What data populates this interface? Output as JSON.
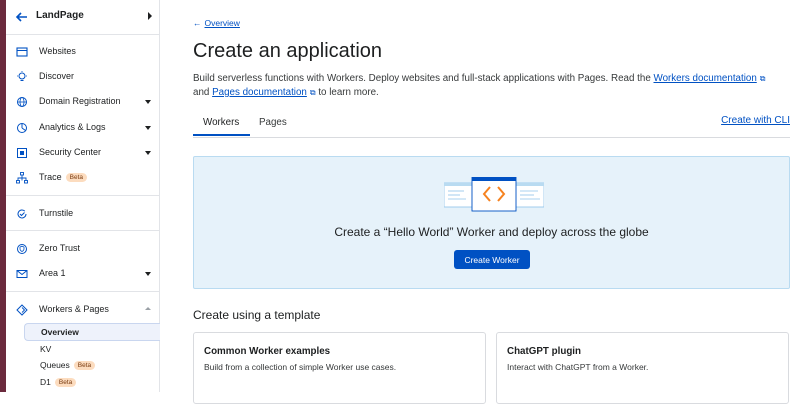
{
  "sidebar": {
    "account_name": "LandPage",
    "items": [
      {
        "label": "Websites",
        "icon": "browser-window-icon"
      },
      {
        "label": "Discover",
        "icon": "lightbulb-icon"
      },
      {
        "label": "Domain Registration",
        "icon": "globe-icon"
      },
      {
        "label": "Analytics & Logs",
        "icon": "pie-chart-icon"
      },
      {
        "label": "Security Center",
        "icon": "security-center-icon"
      },
      {
        "label": "Trace",
        "icon": "network-tree-icon",
        "badge": "Beta"
      },
      {
        "label": "Turnstile",
        "icon": "turnstile-icon"
      },
      {
        "label": "Zero Trust",
        "icon": "shield-icon"
      },
      {
        "label": "Area 1",
        "icon": "mail-icon"
      },
      {
        "label": "Workers & Pages",
        "icon": "workers-icon"
      }
    ],
    "sub_items": [
      {
        "label": "Overview"
      },
      {
        "label": "KV"
      },
      {
        "label": "Queues",
        "badge": "Beta"
      },
      {
        "label": "D1",
        "badge": "Beta"
      }
    ]
  },
  "main": {
    "breadcrumb": "Overview",
    "title": "Create an application",
    "desc_part1": "Build serverless functions with Workers. Deploy websites and full-stack applications with Pages. Read the",
    "workers_doc_link": "Workers documentation",
    "desc_and": "and",
    "pages_doc_link": "Pages documentation",
    "desc_end": "to learn more.",
    "tabs": [
      "Workers",
      "Pages"
    ],
    "cli_link": "Create with CLI",
    "hero_text": "Create a “Hello World” Worker and deploy across the globe",
    "hero_button": "Create Worker",
    "template_heading": "Create using a template",
    "cards": [
      {
        "title": "Common Worker examples",
        "subtitle": "Build from a collection of simple Worker use cases."
      },
      {
        "title": "ChatGPT plugin",
        "subtitle": "Interact with ChatGPT from a Worker."
      }
    ]
  },
  "colors": {
    "accent": "#0051c3",
    "hero_bg": "#e6f2fa",
    "badge_bg": "#fcdcbf",
    "illustration_orange": "#f6821f"
  }
}
